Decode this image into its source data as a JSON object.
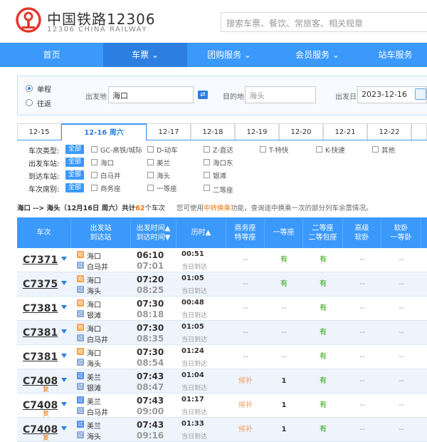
{
  "header": {
    "logo_cn": "中国铁路12306",
    "logo_en": "12306 CHINA RAILWAY",
    "search_placeholder": "搜索车票、餐饮、常旅客、相关规章"
  },
  "nav": [
    {
      "label": "首页"
    },
    {
      "label": "车票 ⌄"
    },
    {
      "label": "团购服务 ⌄"
    },
    {
      "label": "会员服务 ⌄"
    },
    {
      "label": "站车服务"
    }
  ],
  "query": {
    "single_label": "单程",
    "round_label": "往返",
    "from_label": "出发地",
    "from_value": "海口",
    "to_label": "目的地",
    "to_value": "海头",
    "date_label": "出发日",
    "date_value": "2023-12-16"
  },
  "dates": [
    {
      "label": "12-15"
    },
    {
      "label": "12-16 周六"
    },
    {
      "label": "12-17"
    },
    {
      "label": "12-18"
    },
    {
      "label": "12-19"
    },
    {
      "label": "12-20"
    },
    {
      "label": "12-21"
    },
    {
      "label": "12-22"
    }
  ],
  "filters": {
    "all": "全部",
    "rows": [
      {
        "label": "车次类型:",
        "options": [
          "GC-高铁/城际",
          "D-动车",
          "Z-直达",
          "T-特快",
          "K-快速",
          "其他"
        ]
      },
      {
        "label": "出发车站:",
        "options": [
          "海口",
          "美兰",
          "海口东"
        ]
      },
      {
        "label": "到达车站:",
        "options": [
          "白马井",
          "海头",
          "银滩"
        ]
      },
      {
        "label": "车次席别:",
        "options": [
          "商务座",
          "一等座",
          "二等座"
        ]
      }
    ]
  },
  "summary": {
    "route": "海口 --> 海头（12月16日 周六）共计",
    "count": "62",
    "unit": "个车次",
    "hint_pre": "您可使用",
    "hint_link": "中转换乘",
    "hint_post": "功能，查询途中换乘一次的部分列车余票情况。"
  },
  "table": {
    "headers": [
      {
        "l1": "车次",
        "l2": ""
      },
      {
        "l1": "出发站",
        "l2": "到达站"
      },
      {
        "l1": "出发时间▲",
        "l2": "到达时间▼"
      },
      {
        "l1": "历时▲",
        "l2": ""
      },
      {
        "l1": "商务座",
        "l2": "特等座"
      },
      {
        "l1": "一等座",
        "l2": ""
      },
      {
        "l1": "二等座",
        "l2": "二等包座"
      },
      {
        "l1": "高级",
        "l2": "软卧"
      },
      {
        "l1": "软卧",
        "l2": "一等卧"
      }
    ],
    "rows": [
      {
        "no": "C7371",
        "fu": "",
        "from_icon": "始",
        "from": "海口",
        "to_icon": "过",
        "to": "白马井",
        "dep": "06:10",
        "arr": "07:01",
        "dur": "00:51",
        "dur_sub": "当日到达",
        "biz": "--",
        "first": "有",
        "second": "有",
        "adv": "--",
        "soft": "--"
      },
      {
        "no": "C7375",
        "fu": "",
        "from_icon": "始",
        "from": "海口",
        "to_icon": "过",
        "to": "海头",
        "dep": "07:20",
        "arr": "08:25",
        "dur": "01:05",
        "dur_sub": "当日到达",
        "biz": "--",
        "first": "有",
        "second": "有",
        "adv": "--",
        "soft": "--"
      },
      {
        "no": "C7381",
        "fu": "",
        "from_icon": "始",
        "from": "海口",
        "to_icon": "过",
        "to": "银滩",
        "dep": "07:30",
        "arr": "08:18",
        "dur": "00:48",
        "dur_sub": "当日到达",
        "biz": "--",
        "first": "--",
        "second": "有",
        "adv": "--",
        "soft": "--"
      },
      {
        "no": "C7381",
        "fu": "",
        "from_icon": "始",
        "from": "海口",
        "to_icon": "过",
        "to": "白马井",
        "dep": "07:30",
        "arr": "08:35",
        "dur": "01:05",
        "dur_sub": "当日到达",
        "biz": "--",
        "first": "--",
        "second": "有",
        "adv": "--",
        "soft": "--"
      },
      {
        "no": "C7381",
        "fu": "",
        "from_icon": "始",
        "from": "海口",
        "to_icon": "过",
        "to": "海头",
        "dep": "07:30",
        "arr": "08:54",
        "dur": "01:24",
        "dur_sub": "当日到达",
        "biz": "--",
        "first": "--",
        "second": "有",
        "adv": "--",
        "soft": "--"
      },
      {
        "no": "C7408",
        "fu": "复",
        "from_icon": "过",
        "from": "美兰",
        "to_icon": "过",
        "to": "银滩",
        "dep": "07:43",
        "arr": "08:47",
        "dur": "01:04",
        "dur_sub": "当日到达",
        "biz": "候补",
        "first": "1",
        "second": "有",
        "adv": "--",
        "soft": "--"
      },
      {
        "no": "C7408",
        "fu": "复",
        "from_icon": "过",
        "from": "美兰",
        "to_icon": "过",
        "to": "白马井",
        "dep": "07:43",
        "arr": "09:00",
        "dur": "01:17",
        "dur_sub": "当日到达",
        "biz": "候补",
        "first": "1",
        "second": "有",
        "adv": "--",
        "soft": "--"
      },
      {
        "no": "C7408",
        "fu": "复",
        "from_icon": "过",
        "from": "美兰",
        "to_icon": "过",
        "to": "海头",
        "dep": "07:43",
        "arr": "09:16",
        "dur": "01:33",
        "dur_sub": "当日到达",
        "biz": "候补",
        "first": "1",
        "second": "有",
        "adv": "--",
        "soft": "--"
      }
    ]
  },
  "colors": {
    "primary": "#3b99fc",
    "accent_orange": "#f0760a",
    "available_green": "#26a306"
  }
}
